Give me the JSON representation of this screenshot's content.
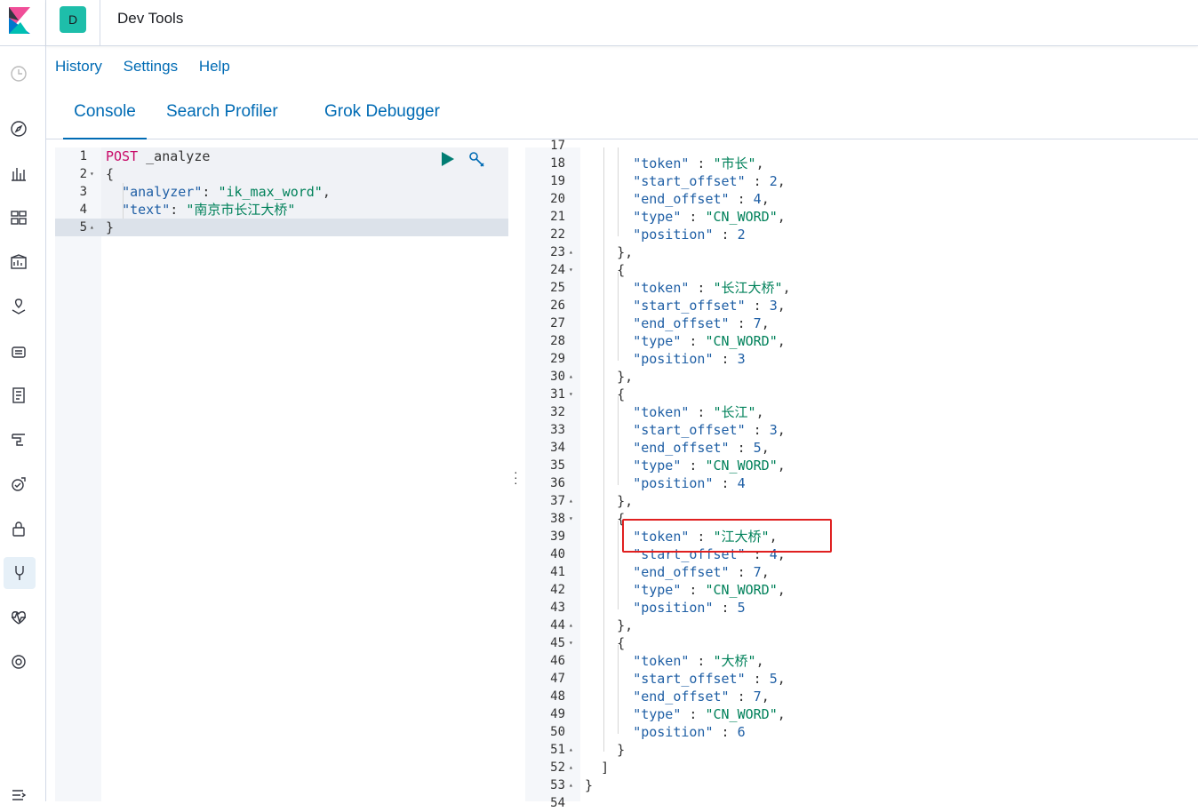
{
  "app": {
    "title": "Dev Tools",
    "space_initial": "D"
  },
  "menu": {
    "history": "History",
    "settings": "Settings",
    "help": "Help"
  },
  "tabs": [
    {
      "label": "Console",
      "selected": true
    },
    {
      "label": "Search Profiler",
      "selected": false
    },
    {
      "label": "Grok Debugger",
      "selected": false
    }
  ],
  "nav_icons": [
    "recent-icon",
    "discover-icon",
    "visualize-icon",
    "dashboard-icon",
    "canvas-icon",
    "maps-icon",
    "infrastructure-icon",
    "logs-icon",
    "apm-icon",
    "uptime-icon",
    "siem-icon",
    "dev-tools-icon",
    "monitoring-icon",
    "management-icon",
    "collapse-icon"
  ],
  "request": {
    "lines": [
      {
        "n": "1",
        "fold": "",
        "method": "POST",
        "text": " _analyze"
      },
      {
        "n": "2",
        "fold": "▾",
        "text": "{"
      },
      {
        "n": "3",
        "fold": "",
        "key": "\"analyzer\"",
        "sep": ": ",
        "val": "\"ik_max_word\"",
        "end": ","
      },
      {
        "n": "4",
        "fold": "",
        "key": "\"text\"",
        "sep": ": ",
        "val": "\"南京市长江大桥\"",
        "end": ""
      },
      {
        "n": "5",
        "fold": "▴",
        "text": "}"
      }
    ]
  },
  "response": {
    "top_partial": "17",
    "bottom_partial": "54",
    "lines": [
      {
        "n": "18",
        "fold": "",
        "indent": 3,
        "key": "\"token\"",
        "val": "\"市长\"",
        "end": ","
      },
      {
        "n": "19",
        "fold": "",
        "indent": 3,
        "key": "\"start_offset\"",
        "num": "2",
        "end": ","
      },
      {
        "n": "20",
        "fold": "",
        "indent": 3,
        "key": "\"end_offset\"",
        "num": "4",
        "end": ","
      },
      {
        "n": "21",
        "fold": "",
        "indent": 3,
        "key": "\"type\"",
        "val": "\"CN_WORD\"",
        "end": ","
      },
      {
        "n": "22",
        "fold": "",
        "indent": 3,
        "key": "\"position\"",
        "num": "2",
        "end": ""
      },
      {
        "n": "23",
        "fold": "▴",
        "indent": 2,
        "text": "},"
      },
      {
        "n": "24",
        "fold": "▾",
        "indent": 2,
        "text": "{"
      },
      {
        "n": "25",
        "fold": "",
        "indent": 3,
        "key": "\"token\"",
        "val": "\"长江大桥\"",
        "end": ","
      },
      {
        "n": "26",
        "fold": "",
        "indent": 3,
        "key": "\"start_offset\"",
        "num": "3",
        "end": ","
      },
      {
        "n": "27",
        "fold": "",
        "indent": 3,
        "key": "\"end_offset\"",
        "num": "7",
        "end": ","
      },
      {
        "n": "28",
        "fold": "",
        "indent": 3,
        "key": "\"type\"",
        "val": "\"CN_WORD\"",
        "end": ","
      },
      {
        "n": "29",
        "fold": "",
        "indent": 3,
        "key": "\"position\"",
        "num": "3",
        "end": ""
      },
      {
        "n": "30",
        "fold": "▴",
        "indent": 2,
        "text": "},"
      },
      {
        "n": "31",
        "fold": "▾",
        "indent": 2,
        "text": "{"
      },
      {
        "n": "32",
        "fold": "",
        "indent": 3,
        "key": "\"token\"",
        "val": "\"长江\"",
        "end": ","
      },
      {
        "n": "33",
        "fold": "",
        "indent": 3,
        "key": "\"start_offset\"",
        "num": "3",
        "end": ","
      },
      {
        "n": "34",
        "fold": "",
        "indent": 3,
        "key": "\"end_offset\"",
        "num": "5",
        "end": ","
      },
      {
        "n": "35",
        "fold": "",
        "indent": 3,
        "key": "\"type\"",
        "val": "\"CN_WORD\"",
        "end": ","
      },
      {
        "n": "36",
        "fold": "",
        "indent": 3,
        "key": "\"position\"",
        "num": "4",
        "end": ""
      },
      {
        "n": "37",
        "fold": "▴",
        "indent": 2,
        "text": "},"
      },
      {
        "n": "38",
        "fold": "▾",
        "indent": 2,
        "text": "{"
      },
      {
        "n": "39",
        "fold": "",
        "indent": 3,
        "key": "\"token\"",
        "val": "\"江大桥\"",
        "end": ","
      },
      {
        "n": "40",
        "fold": "",
        "indent": 3,
        "key": "\"start_offset\"",
        "num": "4",
        "end": ","
      },
      {
        "n": "41",
        "fold": "",
        "indent": 3,
        "key": "\"end_offset\"",
        "num": "7",
        "end": ","
      },
      {
        "n": "42",
        "fold": "",
        "indent": 3,
        "key": "\"type\"",
        "val": "\"CN_WORD\"",
        "end": ","
      },
      {
        "n": "43",
        "fold": "",
        "indent": 3,
        "key": "\"position\"",
        "num": "5",
        "end": ""
      },
      {
        "n": "44",
        "fold": "▴",
        "indent": 2,
        "text": "},"
      },
      {
        "n": "45",
        "fold": "▾",
        "indent": 2,
        "text": "{"
      },
      {
        "n": "46",
        "fold": "",
        "indent": 3,
        "key": "\"token\"",
        "val": "\"大桥\"",
        "end": ","
      },
      {
        "n": "47",
        "fold": "",
        "indent": 3,
        "key": "\"start_offset\"",
        "num": "5",
        "end": ","
      },
      {
        "n": "48",
        "fold": "",
        "indent": 3,
        "key": "\"end_offset\"",
        "num": "7",
        "end": ","
      },
      {
        "n": "49",
        "fold": "",
        "indent": 3,
        "key": "\"type\"",
        "val": "\"CN_WORD\"",
        "end": ","
      },
      {
        "n": "50",
        "fold": "",
        "indent": 3,
        "key": "\"position\"",
        "num": "6",
        "end": ""
      },
      {
        "n": "51",
        "fold": "▴",
        "indent": 2,
        "text": "}"
      },
      {
        "n": "52",
        "fold": "▴",
        "indent": 1,
        "text": "]"
      },
      {
        "n": "53",
        "fold": "▴",
        "indent": 0,
        "text": "}"
      }
    ]
  }
}
